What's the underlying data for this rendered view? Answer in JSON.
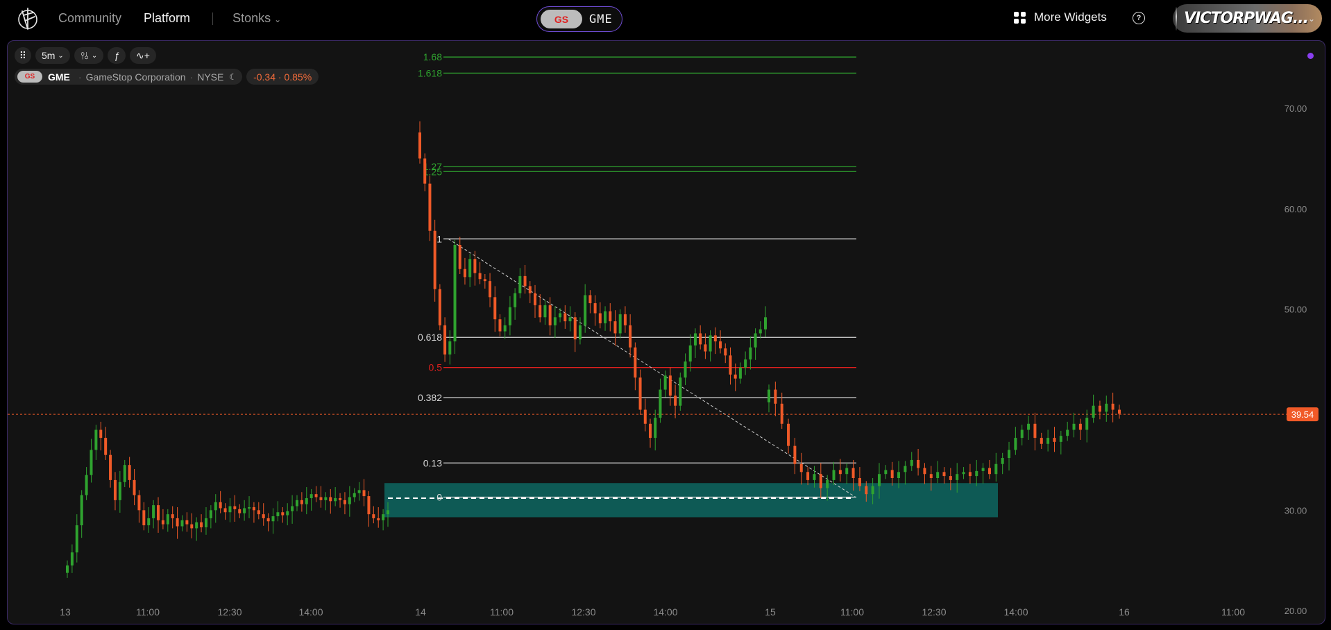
{
  "nav": {
    "community": "Community",
    "platform": "Platform",
    "stonks": "Stonks"
  },
  "ticker": {
    "symbol": "GME",
    "badge": "GS"
  },
  "header": {
    "widgets_label": "More Widgets",
    "help_icon": "?",
    "username": "VICTORPWAG..."
  },
  "toolbar": {
    "timeframe": "5m"
  },
  "instrument": {
    "badge": "GS",
    "symbol": "GME",
    "name": "GameStop Corporation",
    "exchange": "NYSE",
    "change": "-0.34 · 0.85%"
  },
  "colors": {
    "accent_purple": "#6d4bd1",
    "up": "#2fa32f",
    "down": "#f05a28",
    "zone": "#0e5a55",
    "fib_green": "#2fa32f",
    "fib_red": "#e0201e"
  },
  "chart_data": {
    "type": "candlestick",
    "y_axis_ticks": [
      "70.00",
      "60.00",
      "50.00",
      "30.00",
      "20.00"
    ],
    "ylim": [
      18.7,
      76.7
    ],
    "x_axis_ticks": [
      "13",
      "11:00",
      "12:30",
      "14:00",
      "14",
      "11:00",
      "12:30",
      "14:00",
      "15",
      "11:00",
      "12:30",
      "14:00",
      "16",
      "11:00"
    ],
    "last_price": 39.54,
    "last_price_label": "39.54",
    "fib_levels": [
      {
        "label": "1.68",
        "price": 75.1
      },
      {
        "label": "1.618",
        "price": 73.5
      },
      {
        "label": "1.27",
        "price": 64.2
      },
      {
        "label": "1.25",
        "price": 63.7
      },
      {
        "label": "1",
        "price": 57.0
      },
      {
        "label": "0.618",
        "price": 47.2
      },
      {
        "label": "0.5",
        "price": 44.2
      },
      {
        "label": "0.382",
        "price": 41.2
      },
      {
        "label": "0.13",
        "price": 34.7
      },
      {
        "label": "0",
        "price": 31.3
      }
    ],
    "zone": {
      "top": 32.7,
      "bottom": 29.3,
      "line": 31.2
    },
    "candles_close": [
      24.5,
      25.8,
      28.5,
      31.5,
      33.5,
      36.0,
      38.0,
      37.2,
      35.5,
      33.0,
      31.0,
      32.8,
      34.5,
      33.0,
      31.5,
      30.0,
      28.5,
      29.2,
      30.5,
      29.0,
      28.6,
      29.6,
      29.2,
      28.4,
      29.0,
      28.6,
      28.2,
      28.8,
      28.3,
      29.2,
      30.0,
      30.8,
      30.2,
      29.8,
      30.4,
      30.1,
      29.7,
      30.2,
      30.3,
      30.0,
      29.6,
      29.2,
      28.9,
      29.4,
      29.8,
      29.5,
      29.9,
      30.4,
      31.0,
      30.6,
      31.2,
      31.6,
      31.3,
      31.0,
      31.3,
      30.9,
      31.2,
      31.0,
      30.6,
      31.3,
      31.7,
      32.0,
      31.4,
      29.6,
      29.2,
      29.0,
      29.6,
      30.0,
      65.0,
      62.5,
      57.8,
      52.0,
      48.4,
      45.5,
      46.8,
      56.4,
      54.0,
      53.2,
      55.0,
      53.6,
      53.0,
      52.8,
      51.2,
      49.0,
      47.8,
      48.4,
      50.2,
      51.6,
      53.3,
      52.3,
      51.6,
      50.4,
      49.2,
      50.4,
      48.4,
      49.2,
      49.6,
      48.8,
      49.2,
      47.0,
      48.4,
      51.4,
      50.6,
      49.6,
      48.6,
      49.8,
      48.8,
      47.6,
      49.5,
      48.4,
      46.2,
      43.2,
      40.0,
      38.6,
      37.2,
      39.2,
      42.0,
      43.4,
      41.4,
      40.4,
      43.2,
      44.8,
      46.4,
      47.6,
      46.5,
      45.8,
      47.4,
      46.8,
      46.1,
      45.4,
      43.5,
      43.1,
      44.2,
      45.0,
      46.2,
      47.6,
      48.0,
      49.2,
      42.0,
      40.6,
      38.6,
      36.4,
      34.6,
      33.8,
      33.0,
      33.6,
      32.2,
      33.0,
      34.0,
      33.6,
      34.2,
      33.2,
      32.4,
      31.6,
      32.4,
      33.6,
      34.0,
      33.2,
      33.8,
      34.4,
      35.0,
      34.2,
      33.6,
      33.2,
      33.8,
      33.4,
      33.0,
      33.6,
      33.8,
      33.4,
      33.9,
      34.2,
      33.6,
      34.6,
      35.2,
      36.0,
      37.2,
      38.0,
      38.6,
      37.2,
      36.6,
      37.2,
      36.8,
      37.4,
      38.0,
      38.6,
      38.0,
      39.2,
      40.4,
      39.8,
      40.6,
      40.0,
      39.6
    ]
  }
}
